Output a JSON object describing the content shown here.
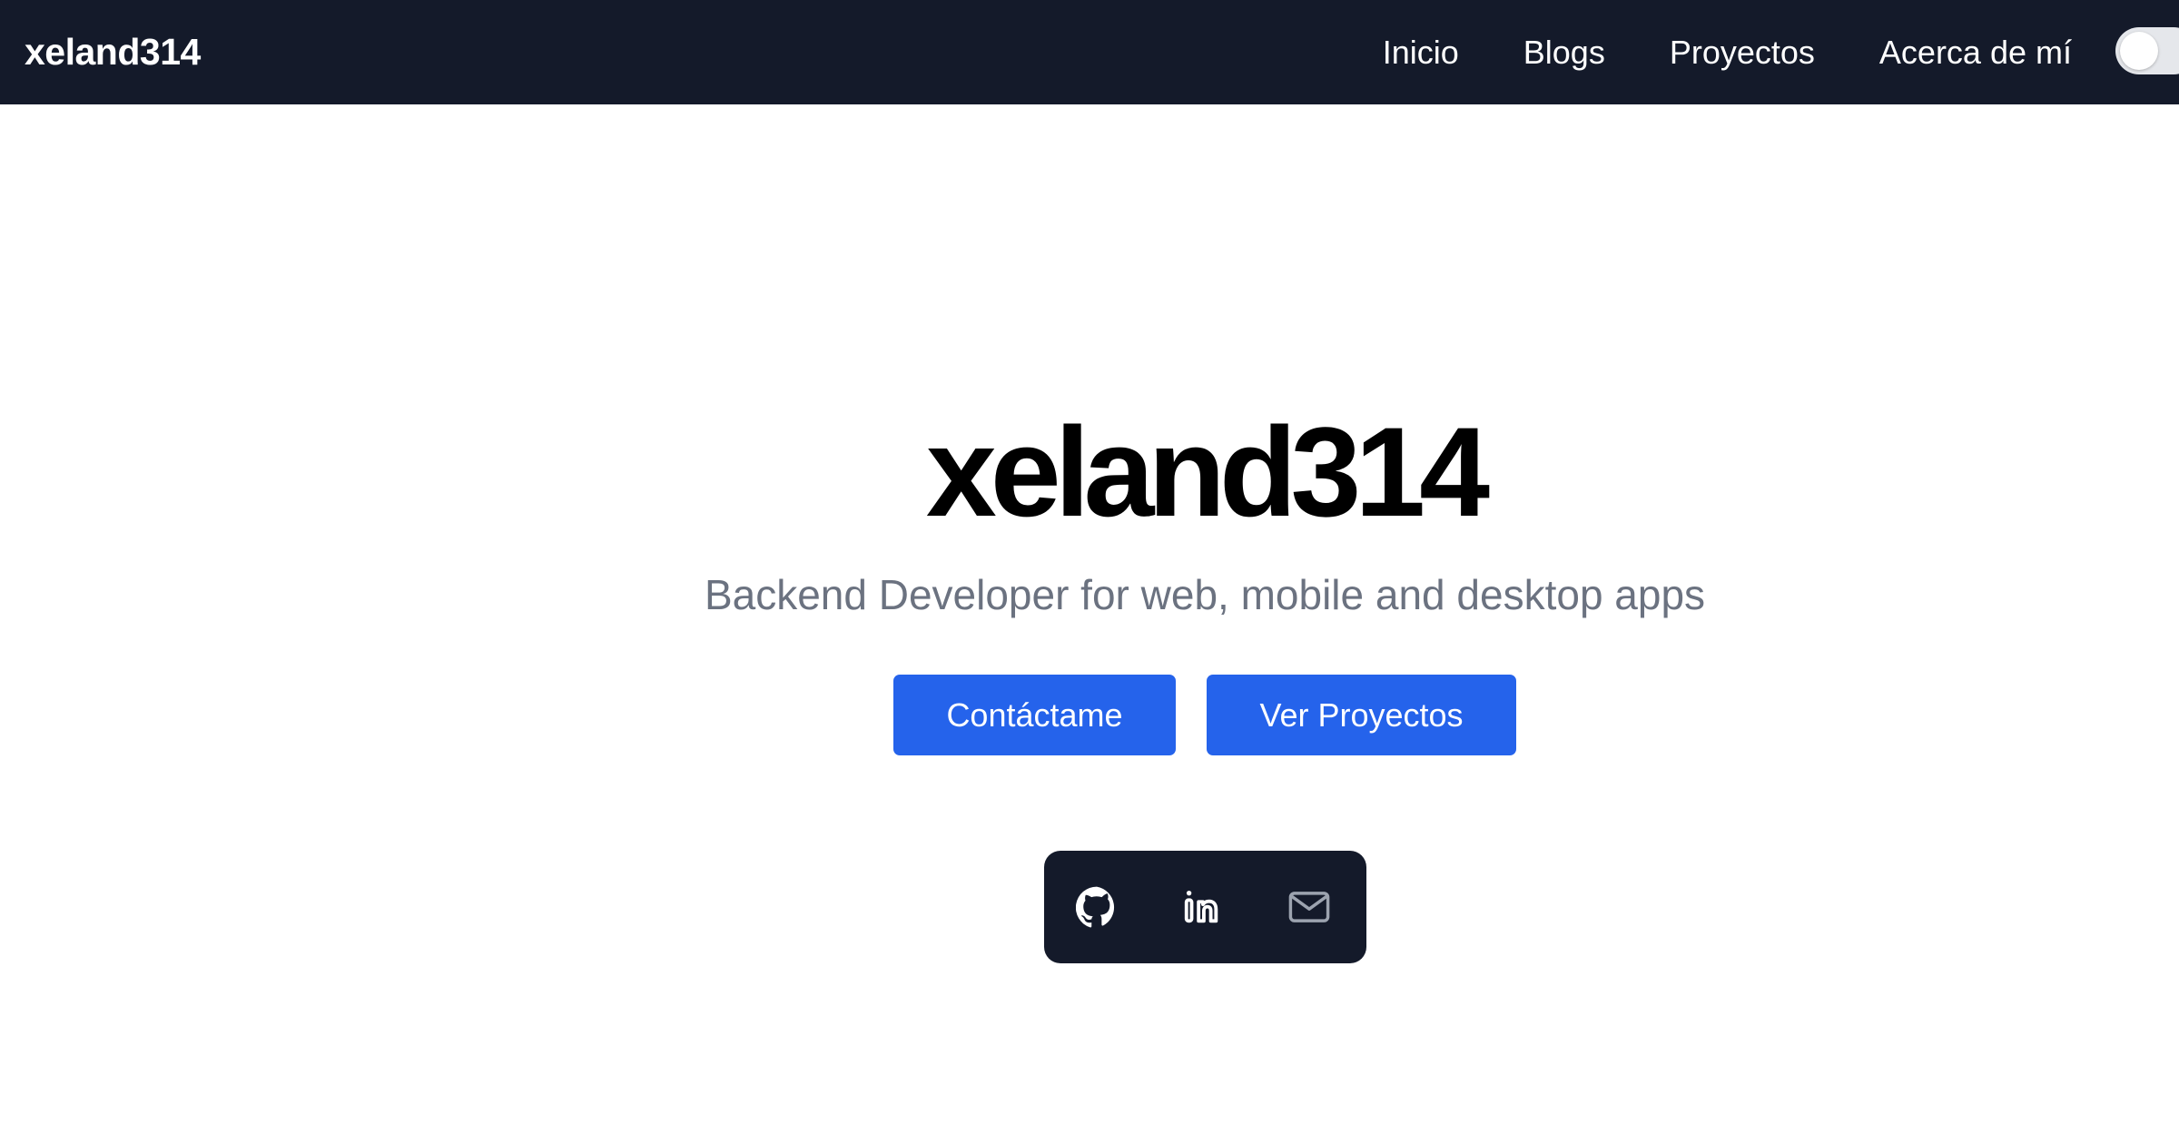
{
  "navbar": {
    "brand": "xeland314",
    "links": [
      "Inicio",
      "Blogs",
      "Proyectos",
      "Acerca de mí"
    ],
    "theme_toggle": {
      "state": "off",
      "icon": "toggle-switch"
    }
  },
  "hero": {
    "title": "xeland314",
    "subtitle": "Backend Developer for web, mobile and desktop apps",
    "buttons": {
      "contact_label": "Contáctame",
      "projects_label": "Ver Proyectos"
    }
  },
  "social": {
    "icons": [
      "github-icon",
      "linkedin-icon",
      "mail-icon"
    ]
  },
  "colors": {
    "navbar_bg": "#141a2a",
    "accent": "#2563eb",
    "subtitle": "#6b7280",
    "mail_icon": "#9ca3af"
  }
}
